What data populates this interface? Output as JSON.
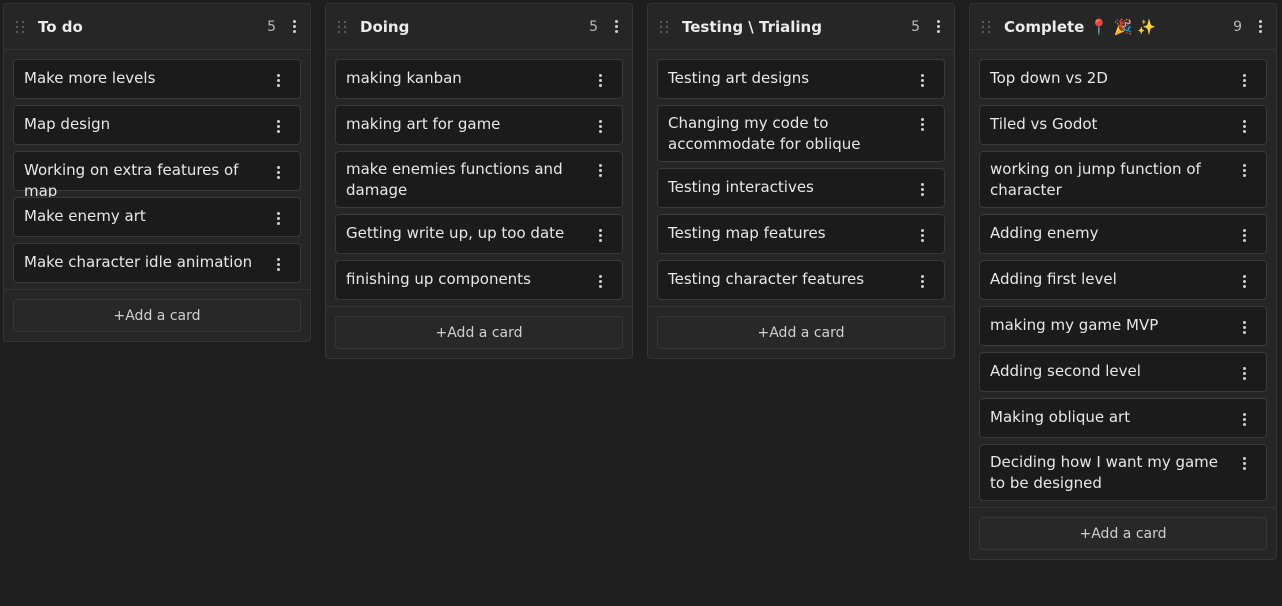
{
  "columns": [
    {
      "title": "To do",
      "count": "5",
      "cards": [
        "Make more levels",
        "Map design",
        "Working on extra features of map",
        "Make enemy art",
        "Make character idle animation"
      ],
      "add_label": "+Add a card"
    },
    {
      "title": "Doing",
      "count": "5",
      "cards": [
        "making kanban",
        "making art for game",
        "make enemies functions and damage",
        "Getting write up, up too date",
        "finishing up components"
      ],
      "add_label": "+Add a card"
    },
    {
      "title": "Testing \\ Trialing",
      "count": "5",
      "cards": [
        "Testing art designs",
        "Changing my code to accommodate for oblique",
        "Testing interactives",
        "Testing map features",
        "Testing character features"
      ],
      "add_label": "+Add a card"
    },
    {
      "title": "Complete 📍 🎉 ✨",
      "count": "9",
      "cards": [
        "Top down vs 2D",
        "Tiled vs Godot",
        "working on jump function of character",
        "Adding enemy",
        "Adding first level",
        "making my game MVP",
        "Adding second level",
        "Making oblique art",
        "Deciding how I want my game to be designed"
      ],
      "add_label": "+Add a card"
    }
  ]
}
